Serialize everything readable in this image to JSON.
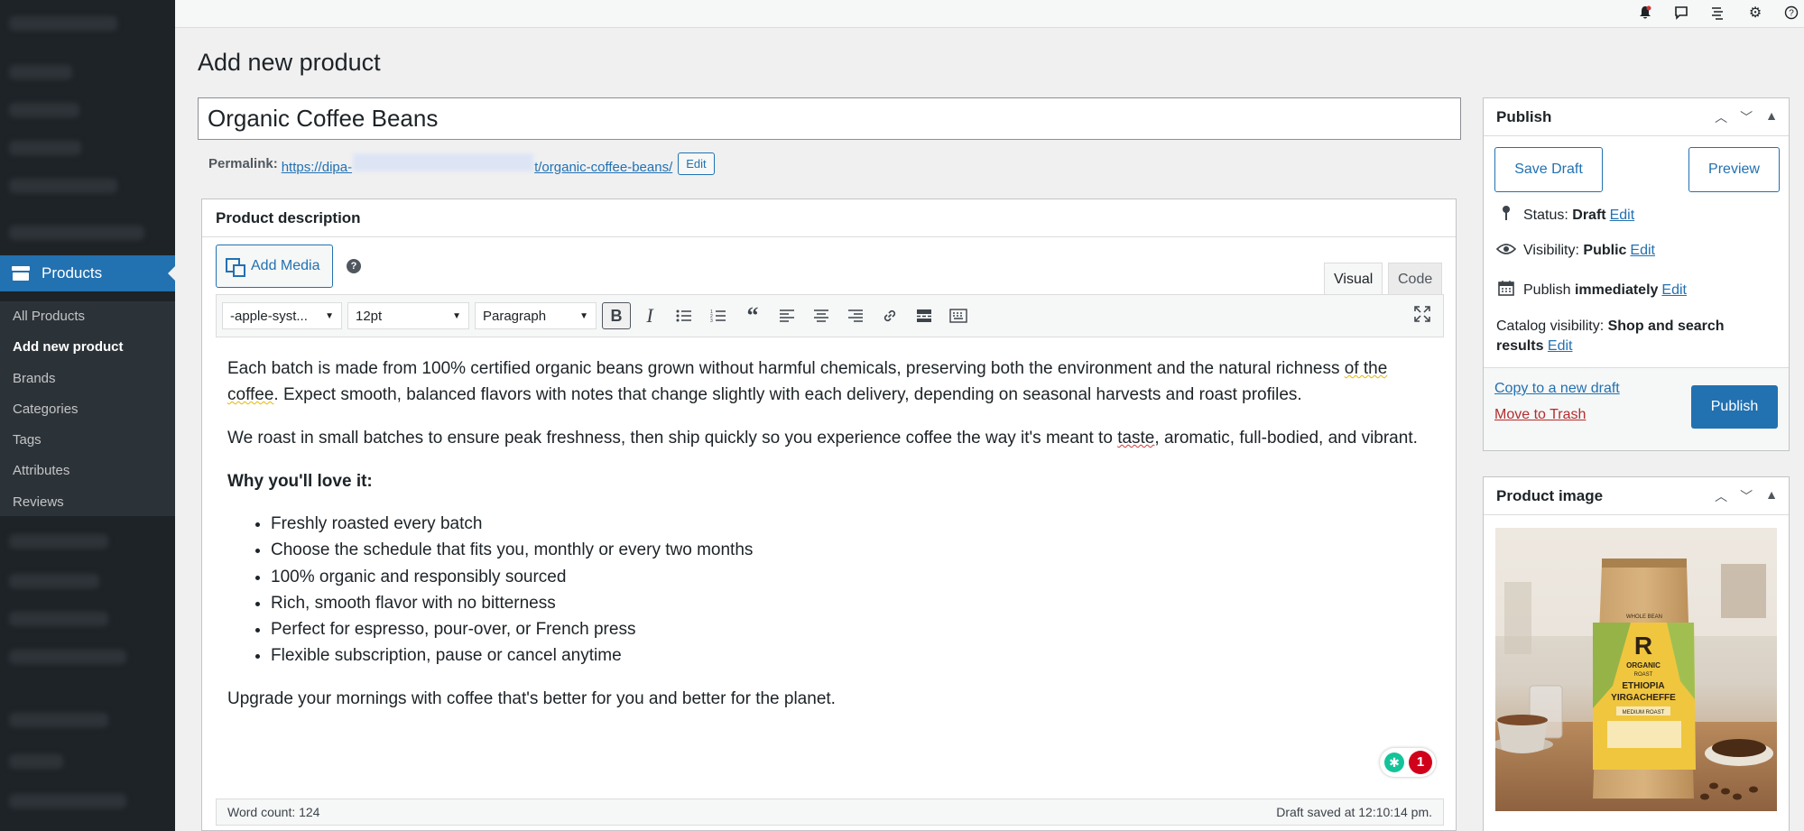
{
  "sidebar": {
    "section_label": "Products",
    "items": [
      {
        "label": "All Products",
        "active": false
      },
      {
        "label": "Add new product",
        "active": true
      },
      {
        "label": "Brands",
        "active": false
      },
      {
        "label": "Categories",
        "active": false
      },
      {
        "label": "Tags",
        "active": false
      },
      {
        "label": "Attributes",
        "active": false
      },
      {
        "label": "Reviews",
        "active": false
      }
    ]
  },
  "topbar": {
    "icons": [
      "bell-icon",
      "comment-icon",
      "list-icon",
      "gear-icon",
      "help-icon"
    ]
  },
  "page": {
    "title": "Add new product"
  },
  "product": {
    "title_value": "Organic Coffee Beans",
    "permalink_label": "Permalink:",
    "permalink_start": "https://dipa-",
    "permalink_end": "t/organic-coffee-beans/",
    "permalink_edit": "Edit"
  },
  "description": {
    "heading": "Product description",
    "add_media": "Add Media",
    "help": "?",
    "tab_visual": "Visual",
    "tab_code": "Code",
    "font_family": "-apple-syst...",
    "font_size": "12pt",
    "block_format": "Paragraph",
    "paragraph1_a": "Each batch is made from 100% certified organic beans grown without harmful chemicals, preserving both the environment and the natural richness ",
    "paragraph1_u": "of the coffee",
    "paragraph1_b": ". Expect smooth, balanced flavors with notes that change slightly with each delivery, depending on seasonal harvests and roast profiles.",
    "paragraph2_a": "We roast in small batches to ensure peak freshness, then ship quickly so you experience coffee the way it's meant to ",
    "paragraph2_u": "taste",
    "paragraph2_b": ", aromatic, full-bodied, and vibrant.",
    "subheading": "Why you'll love it:",
    "bullets": [
      "Freshly roasted every batch",
      "Choose the schedule that fits you, monthly or every two months",
      "100% organic and responsibly sourced",
      "Rich, smooth flavor with no bitterness",
      "Perfect for espresso, pour-over, or French press",
      "Flexible subscription, pause or cancel anytime"
    ],
    "closing": "Upgrade your mornings with coffee that's better for you and better for the planet.",
    "grammar_count": "1",
    "word_count": "Word count: 124",
    "draft_saved": "Draft saved at 12:10:14 pm."
  },
  "publish": {
    "heading": "Publish",
    "save_draft": "Save Draft",
    "preview": "Preview",
    "status_label": "Status:",
    "status_value": "Draft",
    "visibility_label": "Visibility:",
    "visibility_value": "Public",
    "publish_label": "Publish",
    "publish_value": "immediately",
    "catalog_label": "Catalog visibility:",
    "catalog_value_1": "Shop and search",
    "catalog_value_2": "results",
    "edit": "Edit",
    "copy_draft": "Copy to a new draft",
    "trash": "Move to Trash",
    "publish_button": "Publish"
  },
  "product_image": {
    "heading": "Product image",
    "bag_letter": "R",
    "bag_top": "WHOLE BEAN",
    "bag_line1": "ORGANIC",
    "bag_line2": "ROAST",
    "bag_line3": "ETHIOPIA",
    "bag_line4": "YIRGACHEFFE",
    "bag_line5": "MEDIUM ROAST"
  },
  "colors": {
    "accent": "#2271b1",
    "sidebar_bg": "#1d2327",
    "trash": "#b32d2e",
    "grammar_badge": "#d0021b"
  }
}
